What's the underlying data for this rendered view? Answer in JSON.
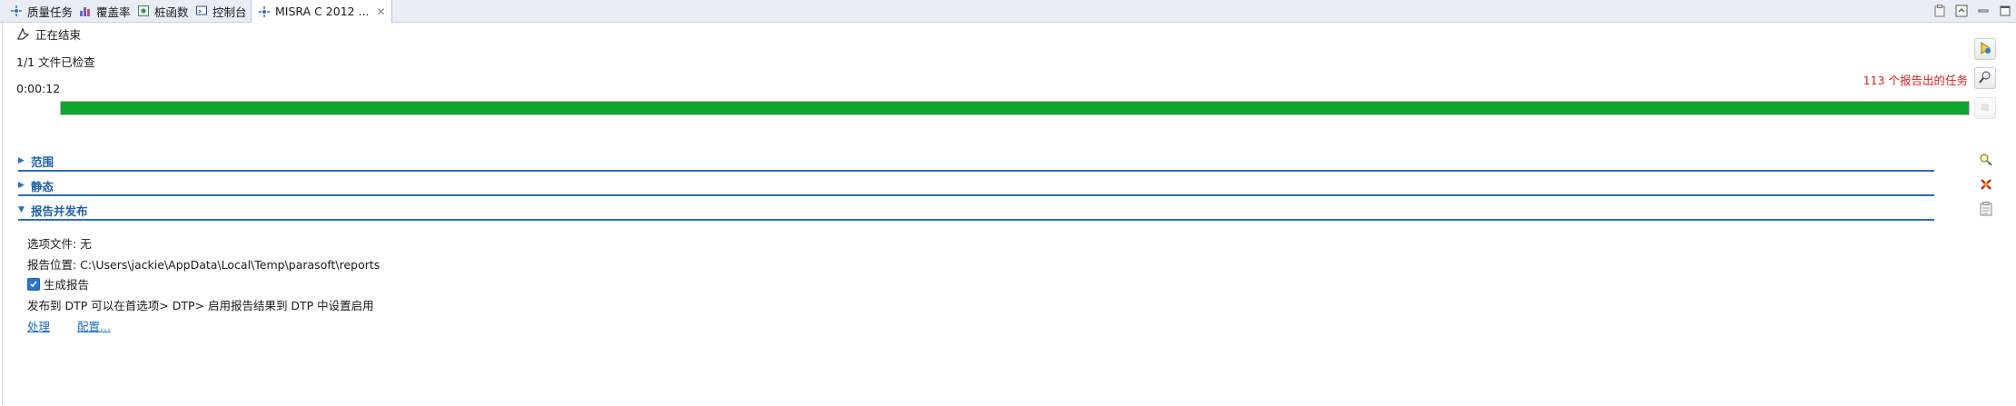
{
  "tabs": [
    {
      "label": "质量任务",
      "icon": "quality-tasks-icon"
    },
    {
      "label": "覆盖率",
      "icon": "coverage-icon"
    },
    {
      "label": "桩函数",
      "icon": "stub-icon"
    },
    {
      "label": "控制台",
      "icon": "console-icon"
    },
    {
      "label": "MISRA C 2012 ...",
      "icon": "misra-icon",
      "active": true
    }
  ],
  "view_tools": [
    "clipboard-icon",
    "restore-icon",
    "minimize-icon",
    "maximize-icon"
  ],
  "status": {
    "text": "正在结束"
  },
  "files": {
    "text": "1/1 文件已检查"
  },
  "time": {
    "text": "0:00:12"
  },
  "progress": {
    "percent": 100,
    "color": "#0ea62e"
  },
  "tasks_link": "113 个报告出的任务",
  "sections": [
    {
      "label": "范围",
      "expanded": false
    },
    {
      "label": "静态",
      "expanded": false
    },
    {
      "label": "报告并发布",
      "expanded": true
    }
  ],
  "report": {
    "options_file": "选项文件: 无",
    "location": "报告位置: C:\\Users\\jackie\\AppData\\Local\\Temp\\parasoft\\reports",
    "generate_label": "生成报告",
    "generate_checked": true,
    "dtp_note": "发布到 DTP 可以在首选项> DTP> 启用报告结果到 DTP 中设置启用",
    "process_link": "处理",
    "configure_link": "配置..."
  },
  "colors": {
    "accent": "#1f5fa8",
    "link": "#1f6fc0",
    "alert": "#e02222",
    "progress": "#0ea62e"
  }
}
